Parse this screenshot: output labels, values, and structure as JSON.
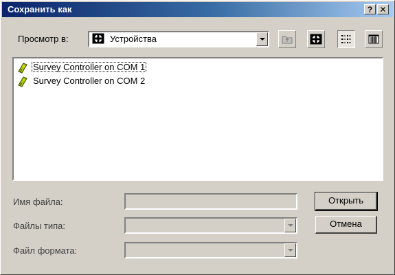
{
  "window": {
    "title": "Сохранить как",
    "help_label": "?",
    "close_label": "✕"
  },
  "lookin": {
    "label": "Просмотр в:",
    "value": "Устройства",
    "icon": "device-folder-icon"
  },
  "toolbar": {
    "buttons": [
      "up-folder-icon",
      "devices-icon",
      "list-view-icon",
      "details-view-icon"
    ]
  },
  "files": [
    {
      "name": "Survey Controller on COM 1",
      "icon": "handheld-device-icon"
    },
    {
      "name": "Survey Controller on COM 2",
      "icon": "handheld-device-icon"
    }
  ],
  "form": {
    "filename_label": "Имя файла:",
    "filename_value": "",
    "filetype_label": "Файлы типа:",
    "filetype_value": "",
    "fileformat_label": "Файл формата:",
    "fileformat_value": ""
  },
  "buttons": {
    "open_label": "Открыть",
    "cancel_label": "Отмена"
  },
  "colors": {
    "titlebar_start": "#0a246a",
    "titlebar_end": "#a6caf0",
    "face": "#d4d0c8"
  }
}
